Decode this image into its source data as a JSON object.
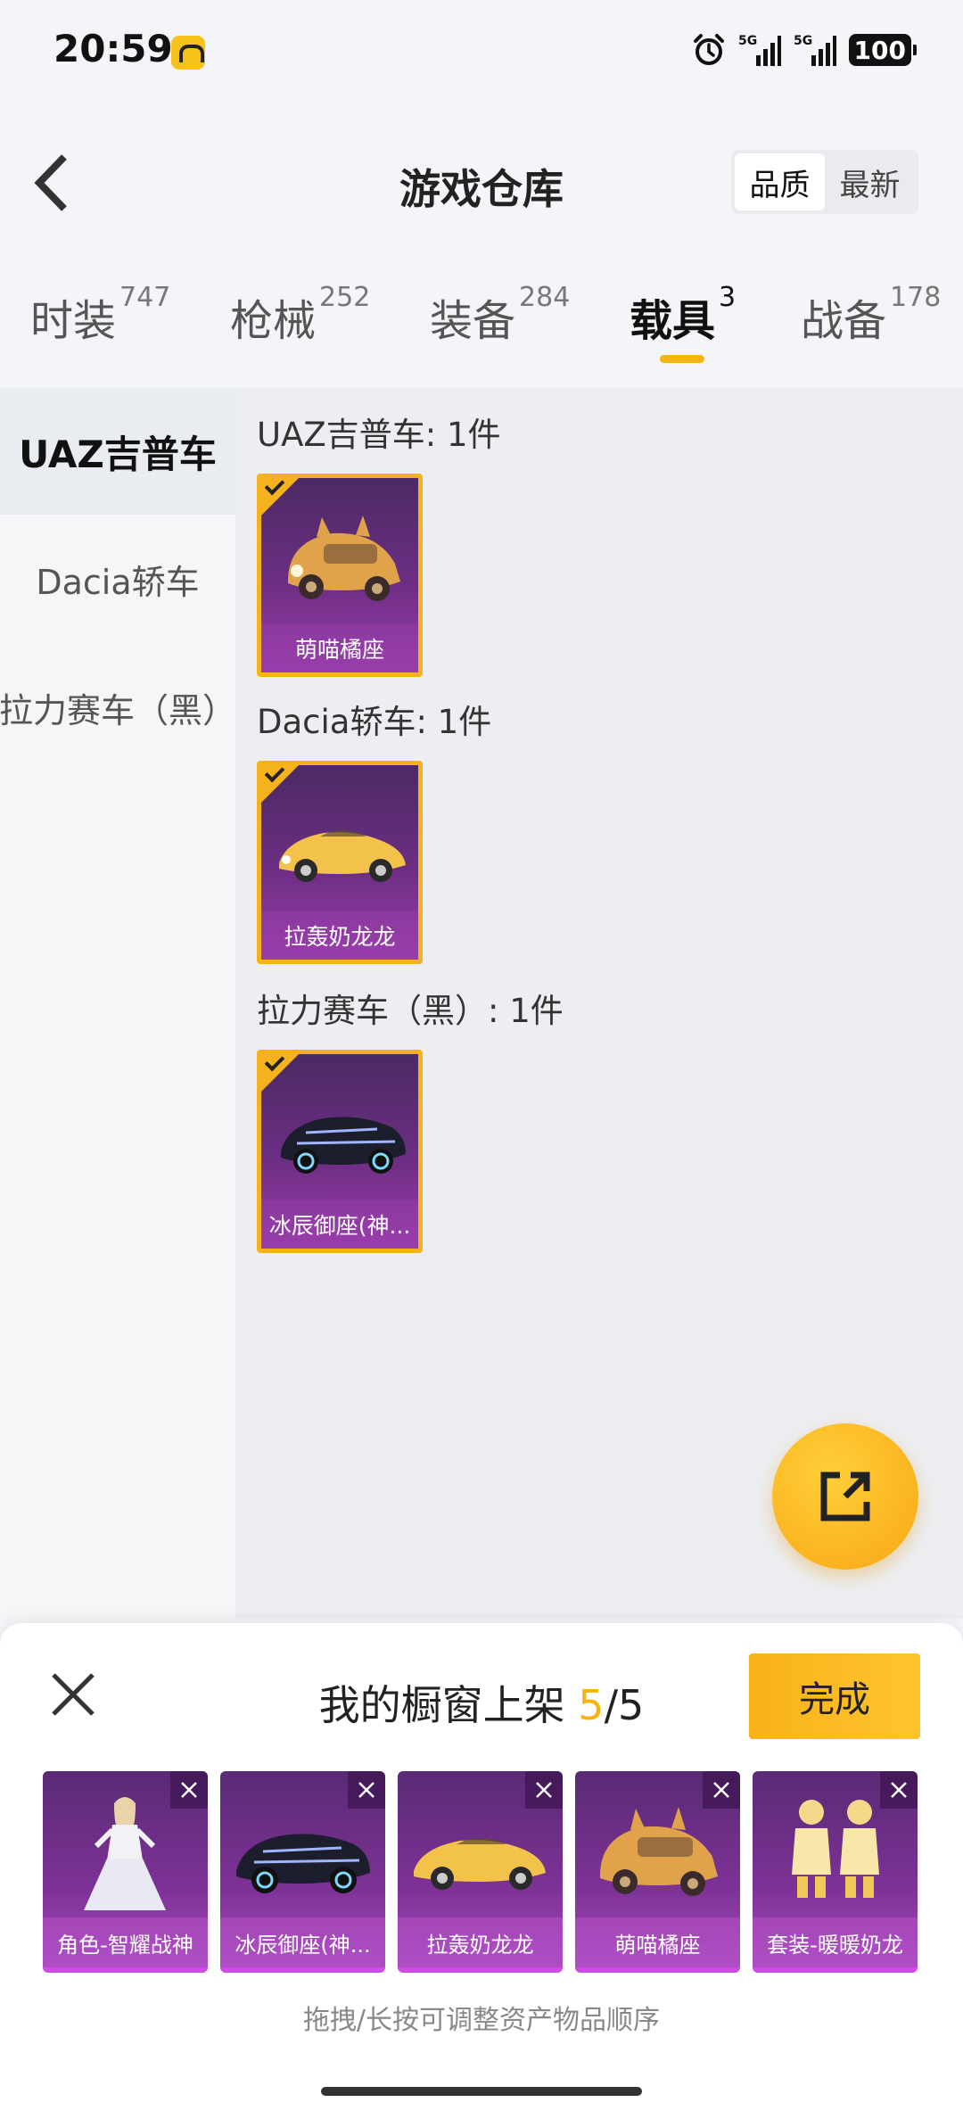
{
  "status": {
    "time": "20:59",
    "battery": "100",
    "net1": "5G",
    "net2": "5G"
  },
  "header": {
    "title": "游戏仓库",
    "sort_options": [
      "品质",
      "最新"
    ],
    "sort_selected": "品质"
  },
  "tabs": [
    {
      "label": "时装",
      "count": "747"
    },
    {
      "label": "枪械",
      "count": "252"
    },
    {
      "label": "装备",
      "count": "284"
    },
    {
      "label": "载具",
      "count": "3",
      "active": true
    },
    {
      "label": "战备",
      "count": "178"
    }
  ],
  "sidebar": {
    "items": [
      "UAZ吉普车",
      "Dacia轿车",
      "拉力赛车（黑）"
    ],
    "active": "UAZ吉普车"
  },
  "groups": [
    {
      "title": "UAZ吉普车: 1件",
      "items": [
        {
          "name": "萌喵橘座",
          "icon": "cat-beetle-car-icon"
        }
      ]
    },
    {
      "title": "Dacia轿车: 1件",
      "items": [
        {
          "name": "拉轰奶龙龙",
          "icon": "yellow-sports-car-icon"
        }
      ]
    },
    {
      "title": "拉力赛车（黑）: 1件",
      "items": [
        {
          "name": "冰辰御座(神...",
          "icon": "black-rally-car-icon"
        }
      ]
    }
  ],
  "panel": {
    "title_prefix": "我的橱窗上架 ",
    "count_current": "5",
    "count_sep_total": "/5",
    "done_label": "完成",
    "hint": "拖拽/长按可调整资产物品顺序",
    "shelf": [
      {
        "name": "角色-智耀战神",
        "icon": "character-figure-icon"
      },
      {
        "name": "冰辰御座(神...",
        "icon": "black-rally-car-icon"
      },
      {
        "name": "拉轰奶龙龙",
        "icon": "yellow-sports-car-icon"
      },
      {
        "name": "萌喵橘座",
        "icon": "cat-beetle-car-icon"
      },
      {
        "name": "套装-暖暖奶龙",
        "icon": "yellow-outfit-icon"
      }
    ]
  },
  "colors": {
    "accent": "#f5b40f",
    "card_border": "#f6b21c",
    "card_purple": "#6d2e84"
  }
}
